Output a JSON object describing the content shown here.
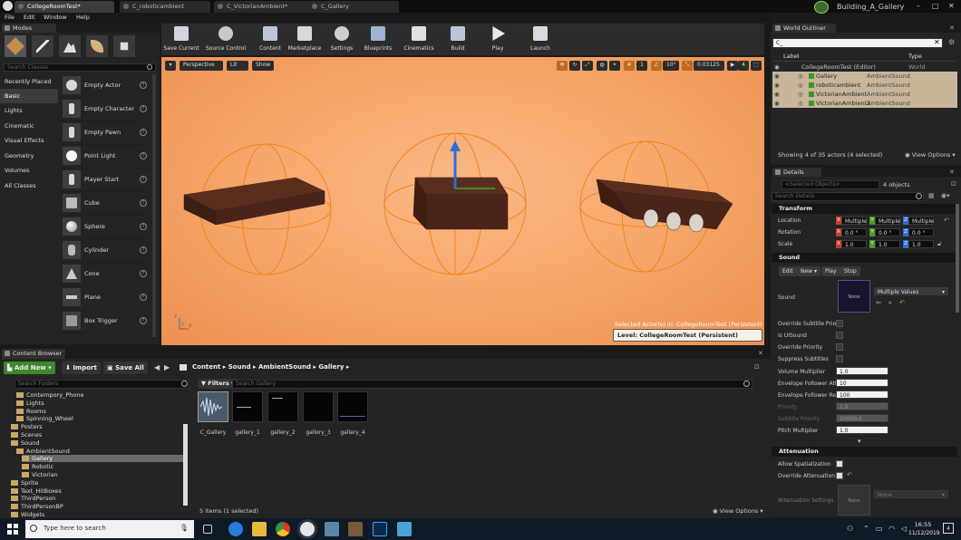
{
  "tabs": [
    {
      "label": "CollegeRoomTest*",
      "active": true
    },
    {
      "label": "C_roboticambient",
      "active": false
    },
    {
      "label": "C_VictorianAmbient*",
      "active": false
    },
    {
      "label": "C_Gallery",
      "active": false
    }
  ],
  "project_name": "Building_A_Gallery",
  "menu": [
    "File",
    "Edit",
    "Window",
    "Help"
  ],
  "modes": {
    "tab_label": "Modes",
    "search_placeholder": "Search Classes",
    "categories": [
      "Recently Placed",
      "Basic",
      "Lights",
      "Cinematic",
      "Visual Effects",
      "Geometry",
      "Volumes",
      "All Classes"
    ],
    "selected_category": "Basic",
    "actors": [
      "Empty Actor",
      "Empty Character",
      "Empty Pawn",
      "Point Light",
      "Player Start",
      "Cube",
      "Sphere",
      "Cylinder",
      "Cone",
      "Plane",
      "Box Trigger"
    ]
  },
  "toolbar": {
    "buttons": [
      "Save Current",
      "Source Control",
      "Content",
      "Marketplace",
      "Settings",
      "Blueprints",
      "Cinematics",
      "Build",
      "Play",
      "Launch"
    ]
  },
  "viewport": {
    "perspective": "Perspective",
    "lit": "Lit",
    "show": "Show",
    "grid_value": "1",
    "angle_value": "10°",
    "scale_value": "0.03125",
    "camera_speed": "4",
    "selected_actor_text": "Selected Actor(s) in:  CollegeRoomTest (Persistent)",
    "level_text": "Level:  CollegeRoomTest (Persistent)"
  },
  "outliner": {
    "tab_label": "World Outliner",
    "search_value": "C_",
    "col_label": "Label",
    "col_type": "Type",
    "rows": [
      {
        "label": "CollegeRoomTest (Editor)",
        "type": "World",
        "selected": false
      },
      {
        "label": "Gallery",
        "type": "AmbientSound",
        "selected": true
      },
      {
        "label": "roboticambient",
        "type": "AmbientSound",
        "selected": true
      },
      {
        "label": "VictorianAmbient",
        "type": "AmbientSound",
        "selected": true
      },
      {
        "label": "VictorianAmbient2",
        "type": "AmbientSound",
        "selected": true
      }
    ],
    "status": "Showing 4 of 35 actors (4 selected)",
    "view_options": "View Options"
  },
  "details": {
    "tab_label": "Details",
    "selected_objects": "<Selected Objects>",
    "object_count": "4 objects",
    "search_placeholder": "Search Details",
    "transform": {
      "title": "Transform",
      "location_label": "Location",
      "rotation_label": "Rotation",
      "scale_label": "Scale",
      "location": [
        "Multiple",
        "Multiple",
        "Multiple"
      ],
      "rotation": [
        "0.0 °",
        "0.0 °",
        "0.0 °"
      ],
      "scale": [
        "1.0",
        "1.0",
        "1.0"
      ]
    },
    "sound": {
      "title": "Sound",
      "edit": "Edit",
      "new": "New",
      "play": "Play",
      "stop": "Stop",
      "sound_label": "Sound",
      "thumb_label": "None",
      "sound_value": "Multiple Values",
      "props": [
        {
          "label": "Override Subtitle Prior",
          "type": "check",
          "value": false
        },
        {
          "label": "Is UISound",
          "type": "check",
          "value": false
        },
        {
          "label": "Override Priority",
          "type": "check",
          "value": false
        },
        {
          "label": "Suppress Subtitles",
          "type": "check",
          "value": false
        },
        {
          "label": "Volume Multiplier",
          "type": "num",
          "value": "1.0"
        },
        {
          "label": "Envelope Follower Atta",
          "type": "num",
          "value": "10"
        },
        {
          "label": "Envelope Follower Rele",
          "type": "num",
          "value": "100"
        },
        {
          "label": "Priority",
          "type": "num",
          "value": "1.0"
        },
        {
          "label": "Subtitle Priority",
          "type": "num",
          "value": "10000.0"
        },
        {
          "label": "Pitch Multiplier",
          "type": "num",
          "value": "1.0"
        }
      ]
    },
    "attenuation": {
      "title": "Attenuation",
      "allow_label": "Allow Spatialization",
      "override_label": "Override Attenuation",
      "settings_label": "Attenuation Settings",
      "thumb_label": "None",
      "settings_value": "None"
    }
  },
  "content_browser": {
    "tab_label": "Content Browser",
    "add_new": "Add New",
    "import": "Import",
    "save_all": "Save All",
    "breadcrumb": [
      "Content",
      "Sound",
      "AmbientSound",
      "Gallery"
    ],
    "search_folders": "Search Folders",
    "filters": "Filters",
    "search_gallery": "Search Gallery",
    "folders": [
      {
        "label": "Contempory_Phone",
        "indent": 2,
        "selected": false
      },
      {
        "label": "Lights",
        "indent": 2,
        "selected": false
      },
      {
        "label": "Rooms",
        "indent": 2,
        "selected": false
      },
      {
        "label": "Spinning_Wheel",
        "indent": 2,
        "selected": false
      },
      {
        "label": "Posters",
        "indent": 1,
        "selected": false
      },
      {
        "label": "Scenes",
        "indent": 1,
        "selected": false
      },
      {
        "label": "Sound",
        "indent": 1,
        "selected": false
      },
      {
        "label": "AmbientSound",
        "indent": 2,
        "selected": false
      },
      {
        "label": "Gallery",
        "indent": 3,
        "selected": true
      },
      {
        "label": "Robotic",
        "indent": 3,
        "selected": false
      },
      {
        "label": "Victorian",
        "indent": 3,
        "selected": false
      },
      {
        "label": "Sprite",
        "indent": 1,
        "selected": false
      },
      {
        "label": "Text_HitBoxes",
        "indent": 1,
        "selected": false
      },
      {
        "label": "ThirdPerson",
        "indent": 1,
        "selected": false
      },
      {
        "label": "ThirdPersonBP",
        "indent": 1,
        "selected": false
      },
      {
        "label": "Widgets",
        "indent": 1,
        "selected": false
      }
    ],
    "assets": [
      "C_Gallery",
      "gallery_1",
      "gallery_2",
      "gallery_3",
      "gallery_4"
    ],
    "status": "5 items (1 selected)",
    "view_options": "View Options"
  },
  "taskbar": {
    "search_placeholder": "Type here to search",
    "time": "16:55",
    "date": "11/12/2019",
    "notification_count": "4"
  },
  "colors": {
    "accent_selection": "#c8b59a",
    "viewport_bg": "#f7a86c",
    "add_new_green": "#3b8a2a"
  }
}
